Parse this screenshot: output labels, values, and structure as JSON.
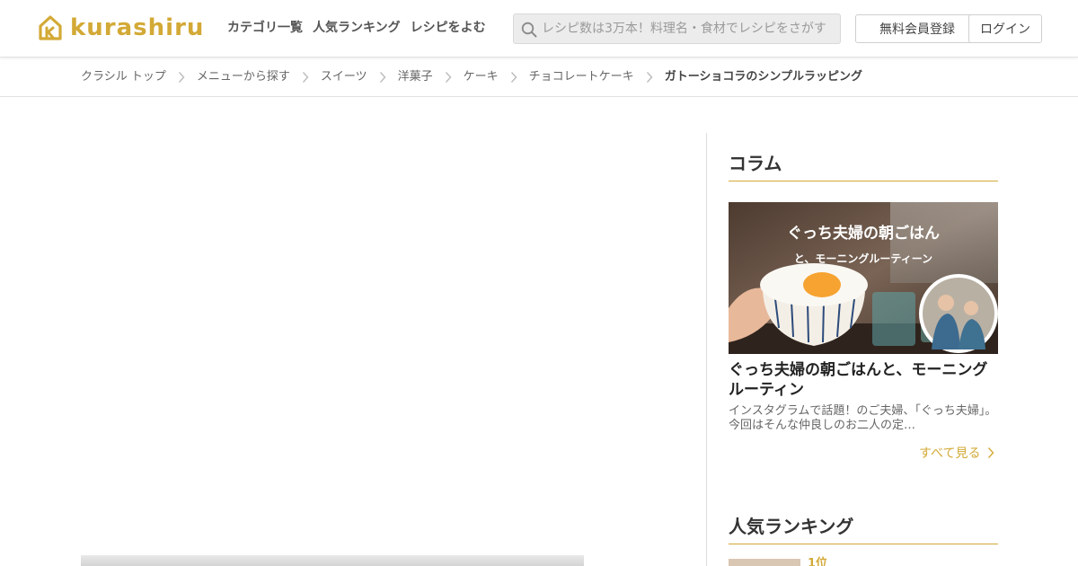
{
  "header": {
    "logo_text": "kurashiru",
    "brand_color": "#d3a936",
    "nav": [
      {
        "label": "カテゴリ一覧"
      },
      {
        "label": "人気ランキング"
      },
      {
        "label": "レシピをよむ"
      }
    ],
    "search": {
      "placeholder": "レシピ数は3万本！料理名・食材でレシピをさがす",
      "value": ""
    },
    "register_label": "無料会員登録",
    "login_label": "ログイン"
  },
  "breadcrumb": [
    {
      "label": "クラシル トップ"
    },
    {
      "label": "メニューから探す"
    },
    {
      "label": "スイーツ"
    },
    {
      "label": "洋菓子"
    },
    {
      "label": "ケーキ"
    },
    {
      "label": "チョコレートケーキ"
    },
    {
      "label": "ガトーショコラのシンプルラッピング"
    }
  ],
  "sidebar": {
    "column": {
      "heading": "コラム",
      "image_title": "ぐっち夫婦の朝ごはん",
      "image_subtitle": "と、モーニングルーティーン",
      "title": "ぐっち夫婦の朝ごはんと、モーニングルーティン",
      "description": "インスタグラムで話題！のご夫婦、「ぐっち夫婦」。 今回はそんな仲良しのお二人の定…",
      "see_all_label": "すべて見る"
    },
    "ranking": {
      "heading": "人気ランキング",
      "first_label": "1位"
    }
  }
}
